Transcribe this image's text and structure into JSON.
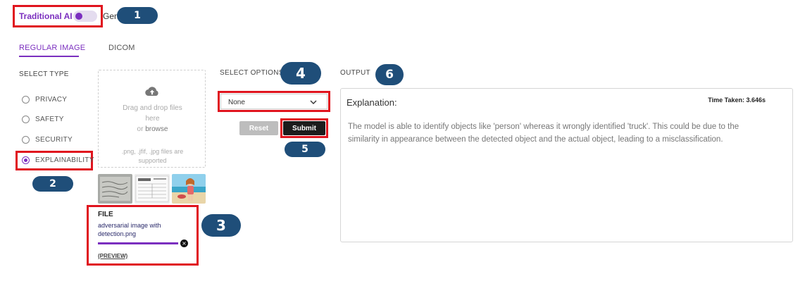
{
  "mode_toggle": {
    "left_label": "Traditional AI",
    "right_label": "Generative AI"
  },
  "tabs": [
    {
      "label": "REGULAR IMAGE",
      "active": true
    },
    {
      "label": "DICOM",
      "active": false
    }
  ],
  "select_type": {
    "heading": "SELECT TYPE",
    "options": [
      {
        "label": "PRIVACY",
        "checked": false
      },
      {
        "label": "SAFETY",
        "checked": false
      },
      {
        "label": "SECURITY",
        "checked": false
      },
      {
        "label": "EXPLAINABILITY",
        "checked": true
      }
    ]
  },
  "upload": {
    "drag_text_1": "Drag and drop files",
    "drag_text_2": "here",
    "or_text": "or",
    "browse_text": "browse",
    "formats_1": ".png, .jfif, .jpg files are",
    "formats_2": "supported",
    "file_heading": "FILE",
    "file_name_1": "adversarial image with",
    "file_name_2": "detection.png",
    "preview_link": "(PREVIEW)",
    "progress": 1.0
  },
  "options": {
    "heading": "SELECT OPTIONS",
    "selected": "None",
    "reset_label": "Reset",
    "submit_label": "Submit"
  },
  "output": {
    "heading": "OUTPUT",
    "title": "Explanation:",
    "time_taken": "Time Taken: 3.646s",
    "text": "The model is able to identify objects like 'person' whereas it wrongly identified 'truck'. This could be due to the similarity in appearance between the detected object and the actual object, leading to a misclassification."
  },
  "callouts": [
    "1",
    "2",
    "3",
    "4",
    "5",
    "6"
  ],
  "colors": {
    "accent": "#7b2fbf",
    "annotation": "#e0141e",
    "callout": "#1f4e79"
  }
}
